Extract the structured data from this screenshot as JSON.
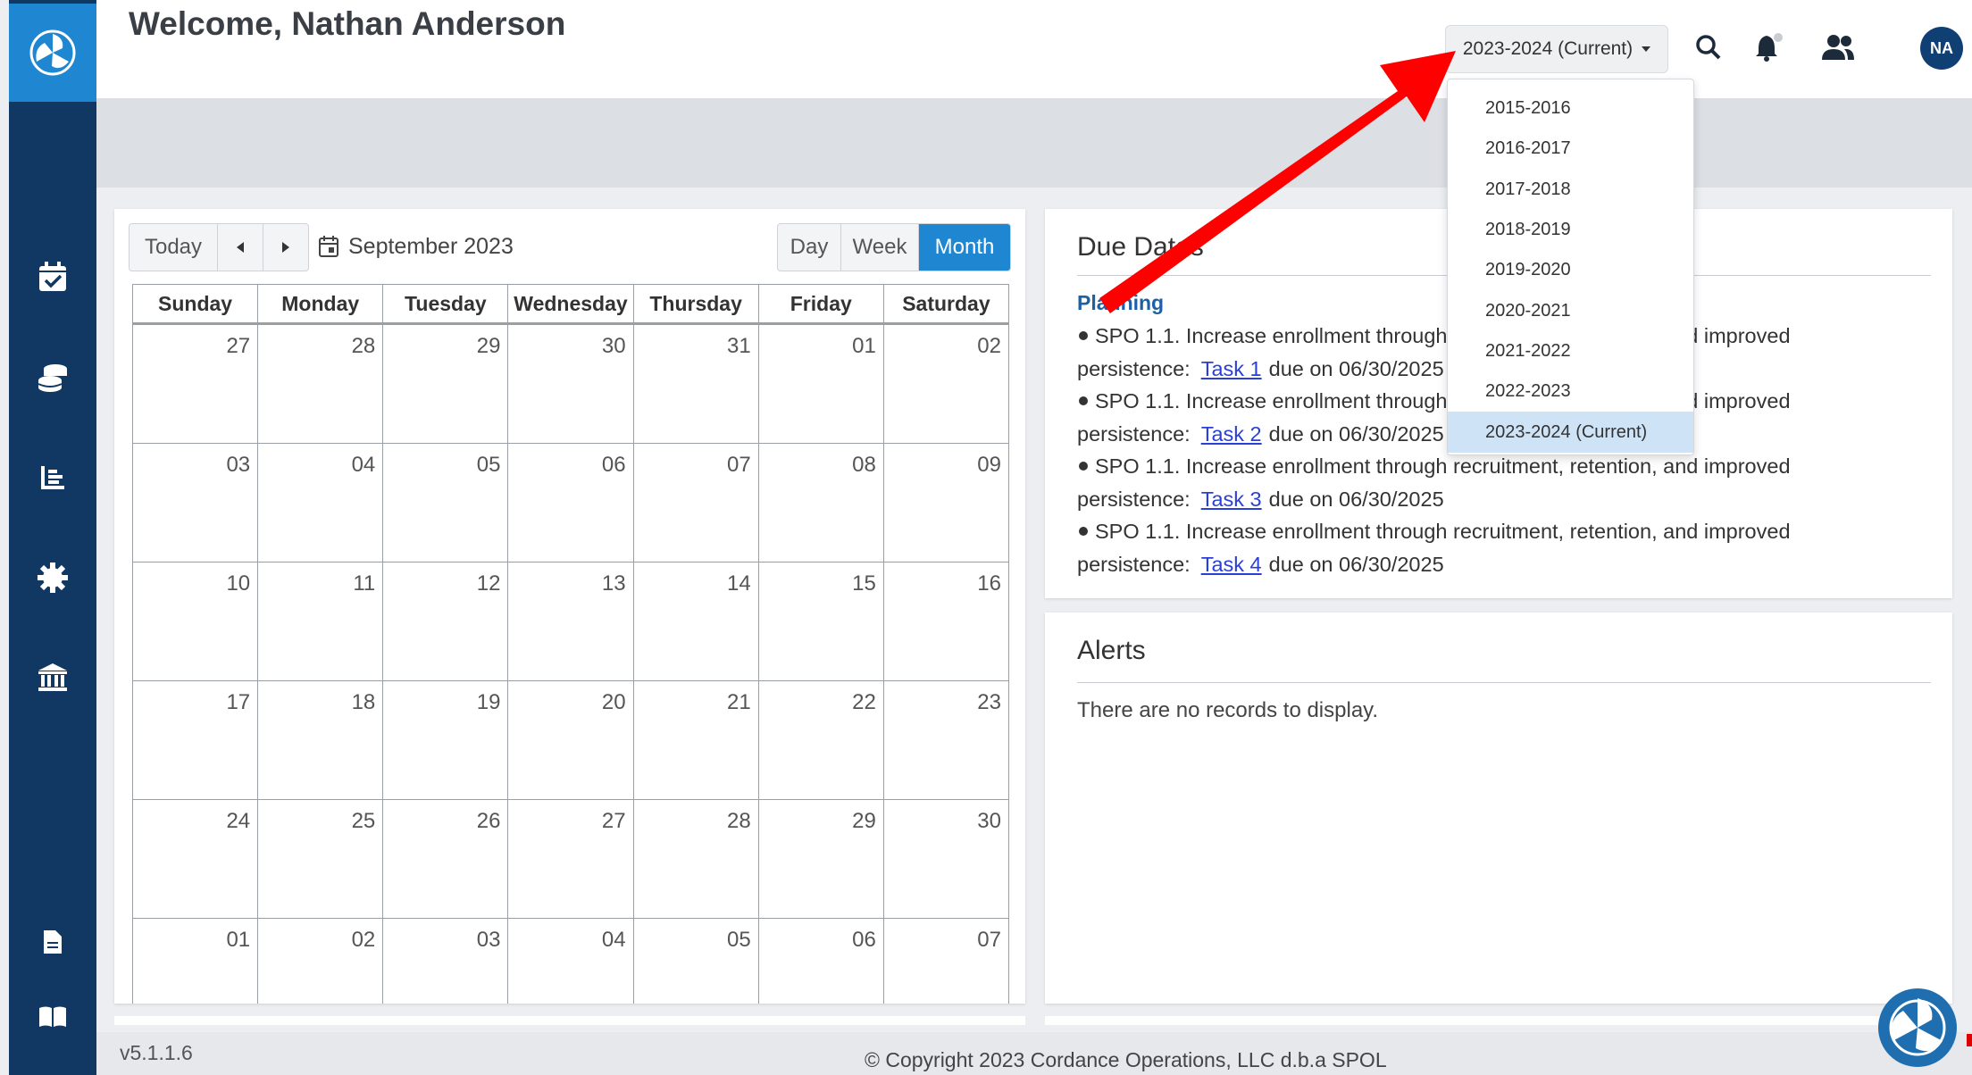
{
  "header": {
    "welcome": "Welcome, Nathan Anderson",
    "year_selector": "2023-2024 (Current)",
    "avatar_initials": "NA"
  },
  "sidebar": {
    "icons": [
      "calendar-check-icon",
      "coins-icon",
      "chart-list-icon",
      "gear-icon",
      "institution-icon",
      "document-icon",
      "book-icon"
    ]
  },
  "calendar": {
    "today": "Today",
    "month_label": "September 2023",
    "views": [
      "Day",
      "Week",
      "Month"
    ],
    "active_view": "Month",
    "weekdays": [
      "Sunday",
      "Monday",
      "Tuesday",
      "Wednesday",
      "Thursday",
      "Friday",
      "Saturday"
    ],
    "weeks": [
      [
        "27",
        "28",
        "29",
        "30",
        "31",
        "01",
        "02"
      ],
      [
        "03",
        "04",
        "05",
        "06",
        "07",
        "08",
        "09"
      ],
      [
        "10",
        "11",
        "12",
        "13",
        "14",
        "15",
        "16"
      ],
      [
        "17",
        "18",
        "19",
        "20",
        "21",
        "22",
        "23"
      ],
      [
        "24",
        "25",
        "26",
        "27",
        "28",
        "29",
        "30"
      ],
      [
        "01",
        "02",
        "03",
        "04",
        "05",
        "06",
        "07"
      ]
    ]
  },
  "due_card": {
    "title": "Due Dates",
    "section": "Planning",
    "tasks": [
      {
        "text": "SPO 1.1. Increase enrollment through recruitment, retention, and improved",
        "prefix": "persistence:",
        "link": "Task 1",
        "due": "due on 06/30/2025"
      },
      {
        "text": "SPO 1.1. Increase enrollment through recruitment, retention, and improved",
        "prefix": "persistence:",
        "link": "Task 2",
        "due": "due on 06/30/2025"
      },
      {
        "text": "SPO 1.1. Increase enrollment through recruitment, retention, and improved",
        "prefix": "persistence:",
        "link": "Task 3",
        "due": "due on 06/30/2025"
      },
      {
        "text": "SPO 1.1. Increase enrollment through recruitment, retention, and improved",
        "prefix": "persistence:",
        "link": "Task 4",
        "due": "due on 06/30/2025"
      }
    ]
  },
  "alerts_card": {
    "title": "Alerts",
    "empty_text": "There are no records to display."
  },
  "year_dropdown": {
    "options": [
      "2015-2016",
      "2016-2017",
      "2017-2018",
      "2018-2019",
      "2019-2020",
      "2020-2021",
      "2021-2022",
      "2022-2023",
      "2023-2024 (Current)"
    ],
    "selected": "2023-2024 (Current)"
  },
  "footer": {
    "version": "v5.1.1.6",
    "copyright": "© Copyright 2023 Cordance Operations, LLC d.b.a SPOL"
  },
  "colors": {
    "sidebar": "#113862",
    "logo_box": "#1f87d1",
    "accent": "#1f87d1",
    "annotation_arrow": "#ff0000"
  }
}
